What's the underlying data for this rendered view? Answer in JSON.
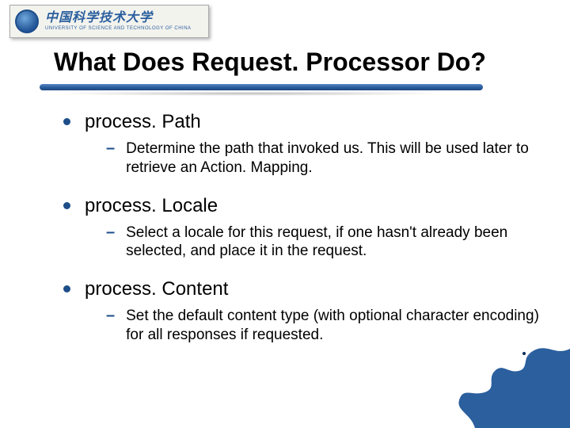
{
  "logo": {
    "cn": "中国科学技术大学",
    "en": "UNIVERSITY OF SCIENCE AND TECHNOLOGY OF CHINA"
  },
  "title": "What Does Request. Processor Do?",
  "items": [
    {
      "heading": "process. Path",
      "sub": "Determine the path that invoked us. This will be used later to retrieve an Action. Mapping."
    },
    {
      "heading": "process. Locale",
      "sub": "Select a locale for this request, if one hasn't already been selected, and place it in the request."
    },
    {
      "heading": "process. Content",
      "sub": "Set the default content type (with optional character encoding) for all responses if requested."
    }
  ],
  "colors": {
    "accent": "#1d4e89",
    "dragon": "#2b5f9e"
  }
}
